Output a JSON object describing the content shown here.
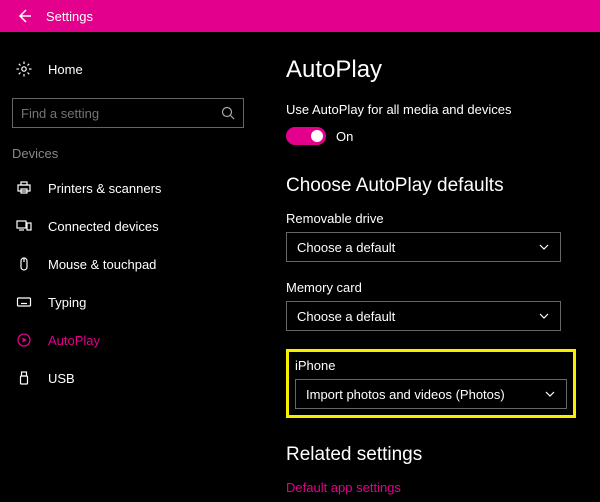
{
  "titlebar": {
    "title": "Settings"
  },
  "sidebar": {
    "home_label": "Home",
    "search_placeholder": "Find a setting",
    "category_label": "Devices",
    "items": [
      {
        "label": "Printers & scanners"
      },
      {
        "label": "Connected devices"
      },
      {
        "label": "Mouse & touchpad"
      },
      {
        "label": "Typing"
      },
      {
        "label": "AutoPlay"
      },
      {
        "label": "USB"
      }
    ]
  },
  "main": {
    "page_title": "AutoPlay",
    "toggle_text": "Use AutoPlay for all media and devices",
    "toggle_state": "On",
    "section_title": "Choose AutoPlay defaults",
    "fields": [
      {
        "label": "Removable drive",
        "value": "Choose a default"
      },
      {
        "label": "Memory card",
        "value": "Choose a default"
      },
      {
        "label": "iPhone",
        "value": "Import photos and videos (Photos)"
      }
    ],
    "related_title": "Related settings",
    "related_link": "Default app settings"
  },
  "colors": {
    "accent": "#e3008c"
  }
}
